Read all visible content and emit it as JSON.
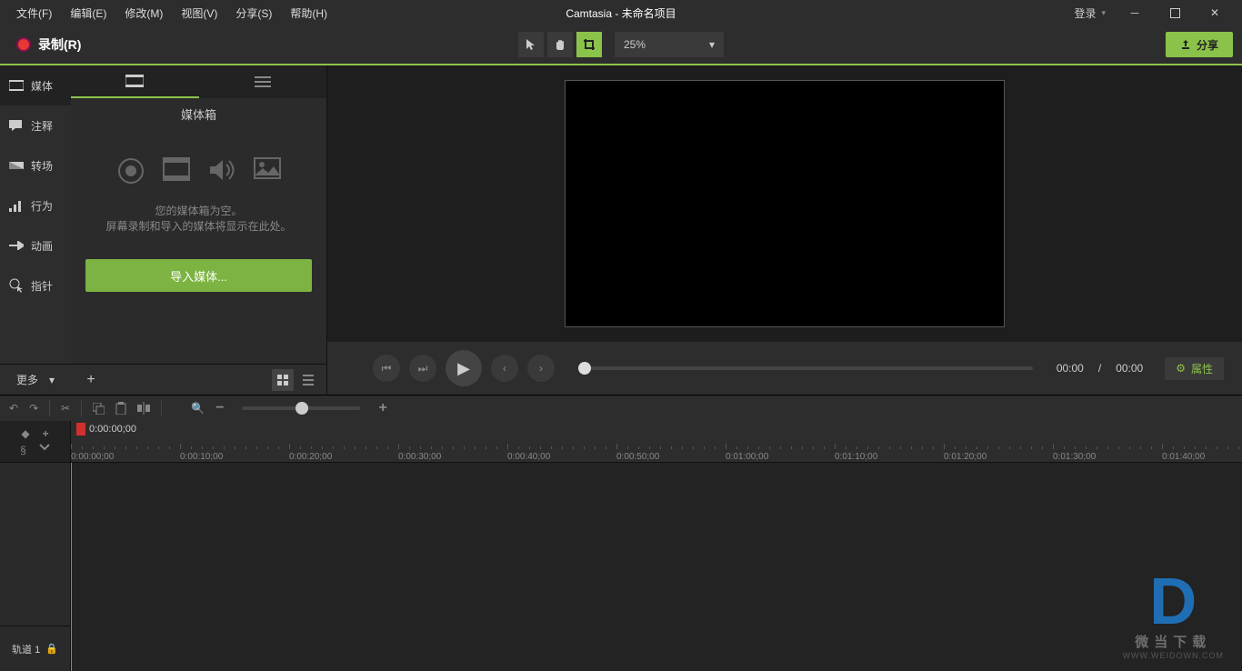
{
  "menu": {
    "file": "文件(F)",
    "edit": "编辑(E)",
    "modify": "修改(M)",
    "view": "视图(V)",
    "share": "分享(S)",
    "help": "帮助(H)"
  },
  "title": "Camtasia - 未命名项目",
  "login": "登录",
  "record_label": "录制(R)",
  "zoom_value": "25%",
  "share_button": "分享",
  "sidebar": {
    "media": "媒体",
    "annotation": "注释",
    "transition": "转场",
    "behavior": "行为",
    "animation": "动画",
    "pointer": "指针",
    "more": "更多"
  },
  "media_bin": {
    "title": "媒体箱",
    "empty_line1": "您的媒体箱为空。",
    "empty_line2": "屏幕录制和导入的媒体将显示在此处。",
    "import_btn": "导入媒体..."
  },
  "playback": {
    "current": "00:00",
    "sep": "/",
    "total": "00:00"
  },
  "properties_btn": "属性",
  "timeline": {
    "playhead": "0:00:00;00",
    "ticks": [
      "0:00:00;00",
      "0:00:10;00",
      "0:00:20;00",
      "0:00:30;00",
      "0:00:40;00",
      "0:00:50;00",
      "0:01:00;00",
      "0:01:10;00",
      "0:01:20;00",
      "0:01:30;00",
      "0:01:40;00"
    ],
    "track1": "轨道 1"
  },
  "watermark": {
    "brand": "微当下载",
    "url": "WWW.WEIDOWN.COM"
  }
}
